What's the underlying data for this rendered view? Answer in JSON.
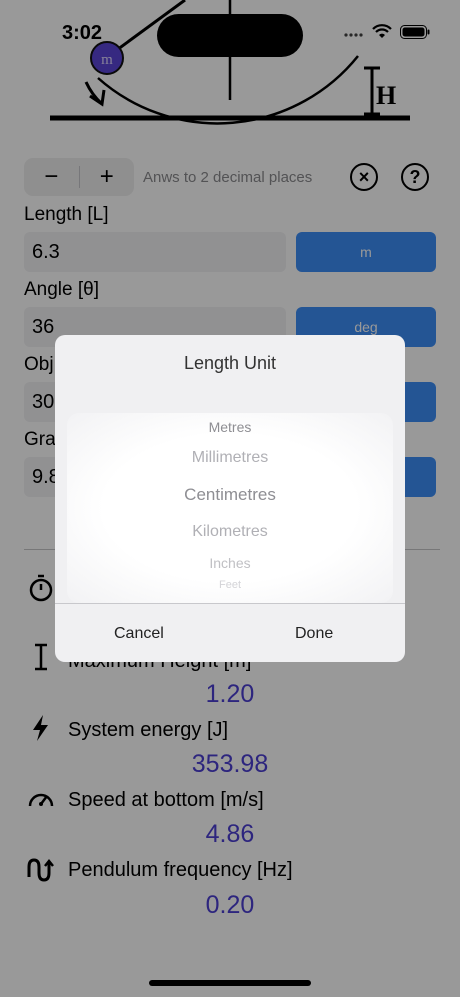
{
  "status": {
    "time": "3:02",
    "icons": [
      "signal-icon",
      "wifi-icon",
      "battery-icon"
    ]
  },
  "diagram": {
    "mass_label": "m",
    "height_label": "H"
  },
  "toolbar": {
    "minus": "−",
    "plus": "+",
    "precision_text": "Anws to 2 decimal places",
    "clear_icon": "×",
    "help_icon": "?"
  },
  "fields": {
    "length": {
      "label": "Length [L]",
      "value": "6.3",
      "unit": "m"
    },
    "angle": {
      "label": "Angle [θ]",
      "value": "36",
      "unit": "deg"
    },
    "object": {
      "label": "Obj",
      "value": "30"
    },
    "gravity": {
      "label": "Gra",
      "value": "9.8"
    }
  },
  "results": {
    "max_height": {
      "label": "Maximum Height [m]",
      "value": "1.20",
      "icon": "height-icon"
    },
    "energy": {
      "label": "System energy [J]",
      "value": "353.98",
      "icon": "bolt-icon"
    },
    "speed": {
      "label": "Speed at bottom [m/s]",
      "value": "4.86",
      "icon": "speedometer-icon"
    },
    "frequency": {
      "label": "Pendulum frequency [Hz]",
      "value": "0.20",
      "icon": "wave-icon"
    }
  },
  "modal": {
    "title": "Length Unit",
    "options": [
      "Metres",
      "Millimetres",
      "Centimetres",
      "Kilometres",
      "Inches",
      "Feet"
    ],
    "selected": "Centimetres",
    "cancel": "Cancel",
    "done": "Done"
  },
  "colors": {
    "accent": "#3d8ef7",
    "result": "#4b3fd3"
  }
}
